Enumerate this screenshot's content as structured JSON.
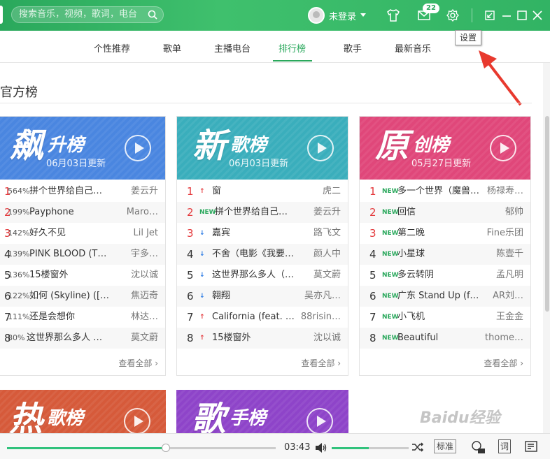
{
  "topbar": {
    "search_placeholder": "搜索音乐，视频，歌词，电台",
    "user_label": "未登录",
    "mail_count": "22",
    "icons": [
      "search-icon",
      "avatar",
      "chevron-down-icon",
      "skin-icon",
      "mail-icon",
      "gear-icon",
      "mini-mode-icon",
      "minimize-icon",
      "maximize-icon",
      "close-icon"
    ]
  },
  "nav": {
    "tabs": [
      "个性推荐",
      "歌单",
      "主播电台",
      "排行榜",
      "歌手",
      "最新音乐"
    ],
    "active": "排行榜"
  },
  "tooltip": "设置",
  "section": {
    "title": "官方榜"
  },
  "charts": [
    {
      "big": "飙",
      "sub": "升榜",
      "date": "06月03日更新",
      "color": "#4a86e0",
      "rows": [
        {
          "rank": "1",
          "pct": "564%",
          "title": "拼个世界给自己…",
          "artist": "姜云升"
        },
        {
          "rank": "2",
          "pct": "199%",
          "title": "Payphone",
          "artist": "Maro…"
        },
        {
          "rank": "3",
          "pct": "142%",
          "title": "好久不见",
          "artist": "Lil Jet"
        },
        {
          "rank": "4",
          "pct": "139%",
          "title": "PINK BLOOD (T…",
          "artist": "宇多…"
        },
        {
          "rank": "5",
          "pct": "136%",
          "title": "15楼窗外",
          "artist": "沈以诚"
        },
        {
          "rank": "6",
          "pct": "122%",
          "title": "如何 (Skyline) ([…",
          "artist": "焦迈奇"
        },
        {
          "rank": "7",
          "pct": "111%",
          "title": "还是会想你",
          "artist": "林达…"
        },
        {
          "rank": "8",
          "pct": "80%",
          "title": "这世界那么多人 …",
          "artist": "莫文蔚"
        }
      ],
      "more": "查看全部"
    },
    {
      "big": "新",
      "sub": "歌榜",
      "date": "06月03日更新",
      "color": "#3aaebc",
      "rows": [
        {
          "rank": "1",
          "mark": "↑",
          "title": "窗",
          "artist": "虎二"
        },
        {
          "rank": "2",
          "mark": "NEW",
          "title": "拼个世界给自己…",
          "artist": "姜云升"
        },
        {
          "rank": "3",
          "mark": "↓",
          "title": "嘉宾",
          "artist": "路飞文"
        },
        {
          "rank": "4",
          "mark": "↓",
          "title": "不舍（电影《我要…",
          "artist": "颜人中"
        },
        {
          "rank": "5",
          "mark": "↓",
          "title": "这世界那么多人（…",
          "artist": "莫文蔚"
        },
        {
          "rank": "6",
          "mark": "↓",
          "title": "翱翔",
          "artist": "吴亦凡…"
        },
        {
          "rank": "7",
          "mark": "↑",
          "title": "California (feat. …",
          "artist": "88risin…"
        },
        {
          "rank": "8",
          "mark": "↑",
          "title": "15楼窗外",
          "artist": "沈以诚"
        }
      ],
      "more": "查看全部"
    },
    {
      "big": "原",
      "sub": "创榜",
      "date": "05月27日更新",
      "color": "#e0477a",
      "rows": [
        {
          "rank": "1",
          "mark": "NEW",
          "title": "多一个世界（魔兽…",
          "artist": "杨禄寿…"
        },
        {
          "rank": "2",
          "mark": "NEW",
          "title": "回信",
          "artist": "郁帅"
        },
        {
          "rank": "3",
          "mark": "NEW",
          "title": "第二晚",
          "artist": "Fine乐团"
        },
        {
          "rank": "4",
          "mark": "NEW",
          "title": "小星球",
          "artist": "陈壹千"
        },
        {
          "rank": "5",
          "mark": "NEW",
          "title": "多云转阴",
          "artist": "孟凡明"
        },
        {
          "rank": "6",
          "mark": "NEW",
          "title": "广东 Stand Up (ft…",
          "artist": "AR刘…"
        },
        {
          "rank": "7",
          "mark": "NEW",
          "title": "小飞机",
          "artist": "王金金"
        },
        {
          "rank": "8",
          "mark": "NEW",
          "title": "Beautiful",
          "artist": "thome…"
        }
      ],
      "more": "查看全部"
    }
  ],
  "charts_bottom": [
    {
      "big": "热",
      "sub": "歌榜",
      "color": "#d65a3a"
    },
    {
      "big": "歌",
      "sub": "手榜",
      "color": "#8e44c9"
    }
  ],
  "player": {
    "time": "03:43",
    "progress": 0.59,
    "volume": 0.48,
    "quality": "标准",
    "lyric_label": "词"
  },
  "watermark": "Baidu经验"
}
